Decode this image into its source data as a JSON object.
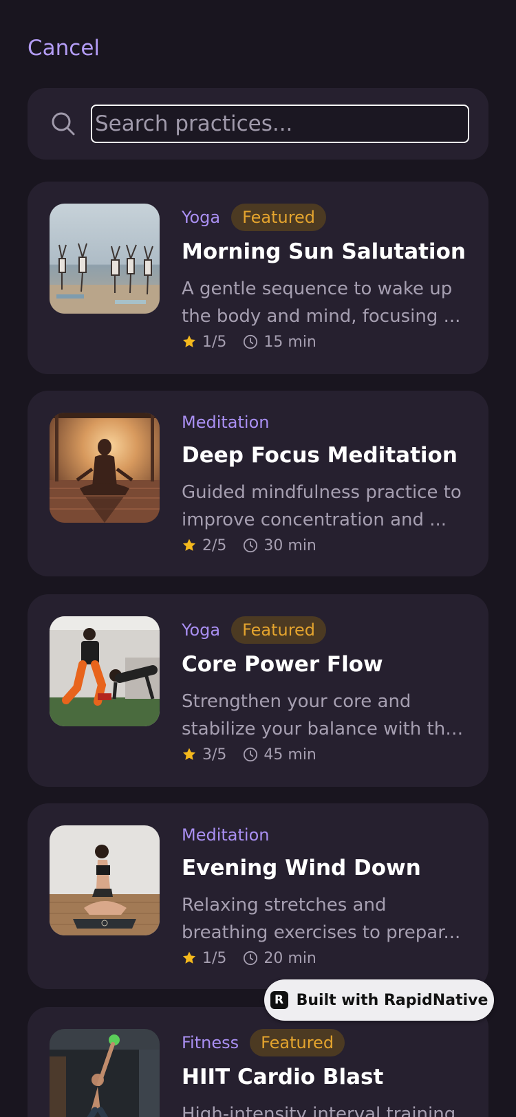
{
  "header": {
    "cancel_label": "Cancel"
  },
  "search": {
    "placeholder": "Search practices...",
    "value": ""
  },
  "practices": [
    {
      "category": "Yoga",
      "featured": true,
      "badge_label": "Featured",
      "title": "Morning Sun Salutation",
      "desc_line1": "A gentle sequence to wake up",
      "desc_line2": "the body and mind, focusing ...",
      "rating": "1/5",
      "duration": "15 min"
    },
    {
      "category": "Meditation",
      "featured": false,
      "title": "Deep Focus Meditation",
      "desc_line1": "Guided mindfulness practice to",
      "desc_line2": "improve concentration and ...",
      "rating": "2/5",
      "duration": "30 min"
    },
    {
      "category": "Yoga",
      "featured": true,
      "badge_label": "Featured",
      "title": "Core Power Flow",
      "desc_line1": "Strengthen your core and",
      "desc_line2": "stabilize your balance with thi...",
      "rating": "3/5",
      "duration": "45 min"
    },
    {
      "category": "Meditation",
      "featured": false,
      "title": "Evening Wind Down",
      "desc_line1": "Relaxing stretches and",
      "desc_line2": "breathing exercises to prepar...",
      "rating": "1/5",
      "duration": "20 min"
    },
    {
      "category": "Fitness",
      "featured": true,
      "badge_label": "Featured",
      "title": "HIIT Cardio Blast",
      "desc_line1": "High-intensity interval training",
      "desc_line2": "",
      "rating": "",
      "duration": ""
    }
  ],
  "icons": {
    "search": "search-icon",
    "rating": "star-icon",
    "duration": "clock-icon",
    "brand": "rapidnative-logo-icon"
  },
  "colors": {
    "background": "#19151f",
    "card": "#26202f",
    "accent": "#a98ff2",
    "cancel": "#b39cf5",
    "featured_text": "#e4a42e",
    "featured_bg": "#4c3a22",
    "star": "#f5b91d",
    "muted_text": "#a69fb1"
  },
  "branding": {
    "logo_letter": "R",
    "label": "Built with RapidNative"
  }
}
